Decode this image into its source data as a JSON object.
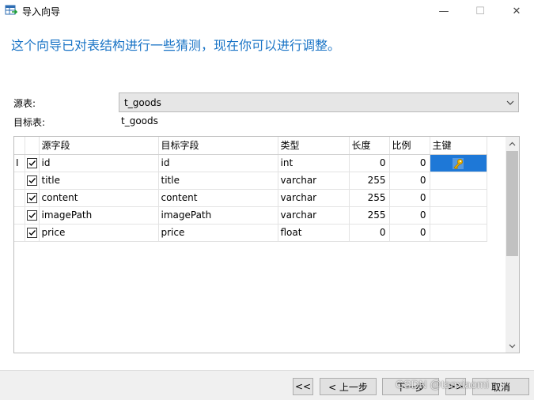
{
  "window": {
    "title": "导入向导",
    "minimize_glyph": "—",
    "maximize_glyph": "☐",
    "close_glyph": "✕"
  },
  "headline": "这个向导已对表结构进行一些猜测，现在你可以进行调整。",
  "source_table": {
    "label": "源表:",
    "value": "t_goods"
  },
  "target_table": {
    "label": "目标表:",
    "value": "t_goods"
  },
  "grid": {
    "columns": [
      "源字段",
      "目标字段",
      "类型",
      "长度",
      "比例",
      "主键"
    ],
    "rows": [
      {
        "checked": true,
        "source": "id",
        "target": "id",
        "type": "int",
        "length": "0",
        "scale": "0",
        "primary_key": true
      },
      {
        "checked": true,
        "source": "title",
        "target": "title",
        "type": "varchar",
        "length": "255",
        "scale": "0",
        "primary_key": false
      },
      {
        "checked": true,
        "source": "content",
        "target": "content",
        "type": "varchar",
        "length": "255",
        "scale": "0",
        "primary_key": false
      },
      {
        "checked": true,
        "source": "imagePath",
        "target": "imagePath",
        "type": "varchar",
        "length": "255",
        "scale": "0",
        "primary_key": false
      },
      {
        "checked": true,
        "source": "price",
        "target": "price",
        "type": "float",
        "length": "0",
        "scale": "0",
        "primary_key": false
      }
    ],
    "current_row_indicator": "I"
  },
  "buttons": {
    "first": "<<",
    "prev": "< 上一步",
    "next": "下一步",
    "last": ">>",
    "cancel": "取消"
  },
  "watermark": "CSDN @tanxiaomi",
  "colors": {
    "headline": "#1a74c6",
    "selection": "#1e78d7",
    "key_icon": "#f0b400"
  }
}
